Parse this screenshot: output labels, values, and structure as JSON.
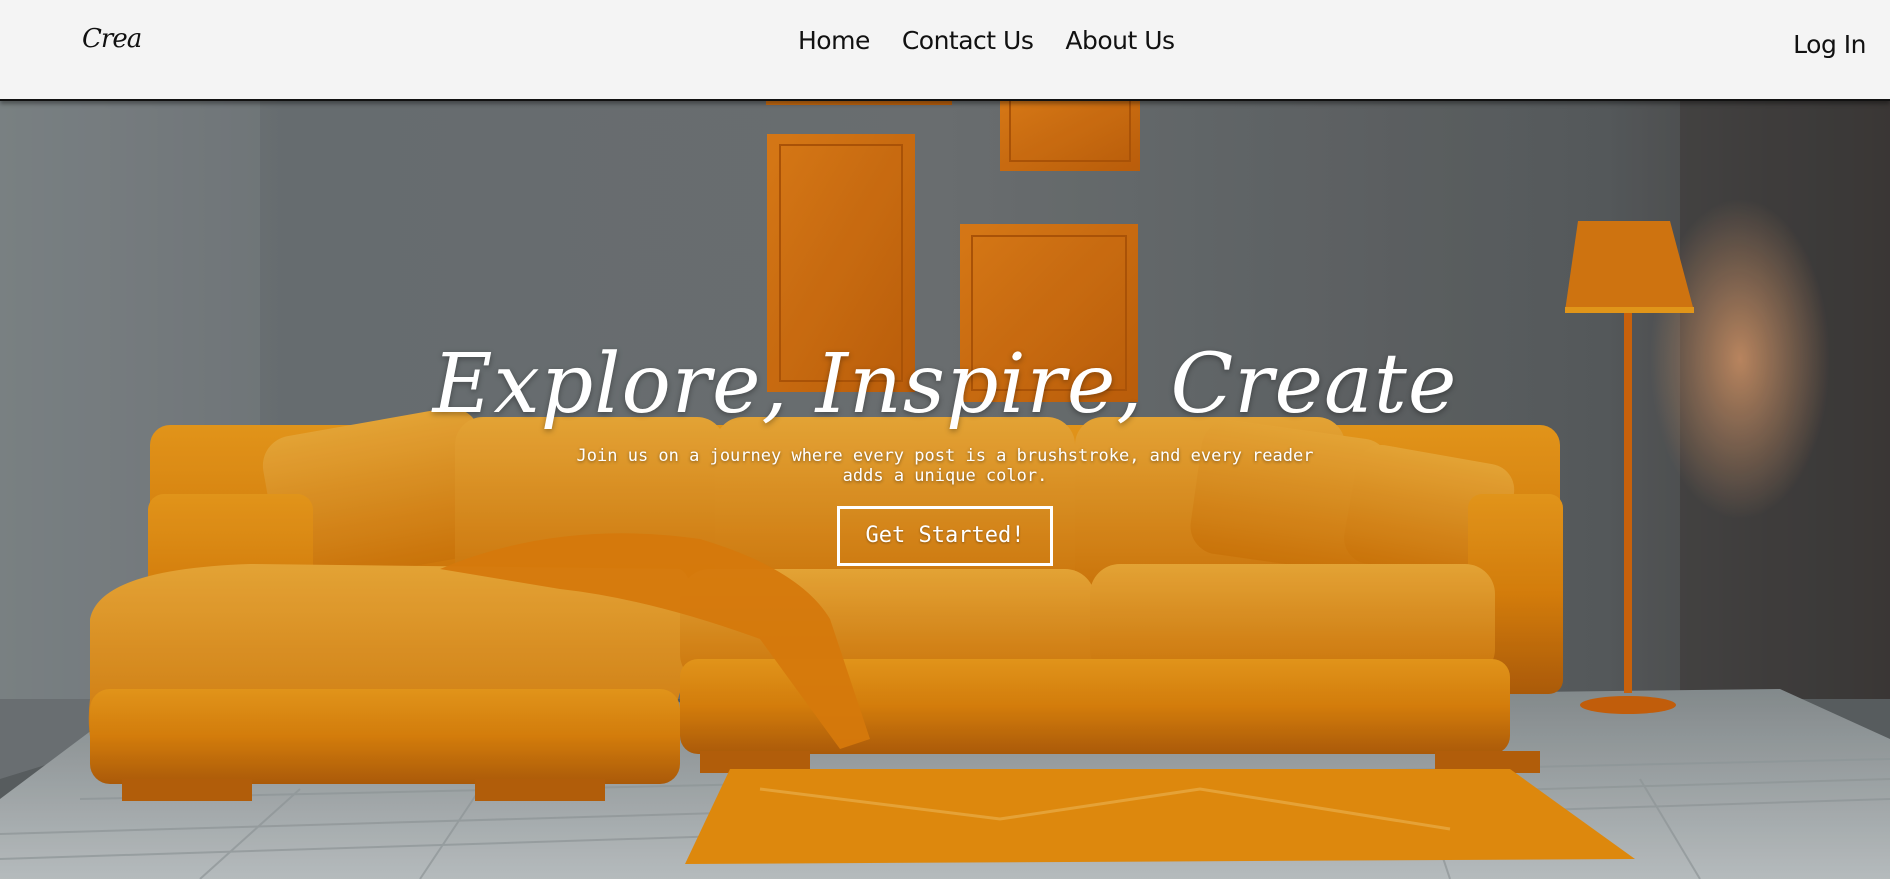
{
  "header": {
    "logo": "Crea",
    "nav": [
      {
        "label": "Home"
      },
      {
        "label": "Contact Us"
      },
      {
        "label": "About Us"
      }
    ],
    "login": "Log In"
  },
  "hero": {
    "title": "Explore, Inspire, Create",
    "subtitle": "Join us on a journey where every post is a brushstroke, and every reader adds a unique color.",
    "cta": "Get Started!",
    "image_description_icon": "living-room-photo"
  },
  "colors": {
    "header_bg": "#f4f4f4",
    "accent_orange": "#e8890c",
    "wall_gray": "#6a6f71",
    "text_light": "#ffffff",
    "text_dark": "#111111"
  }
}
